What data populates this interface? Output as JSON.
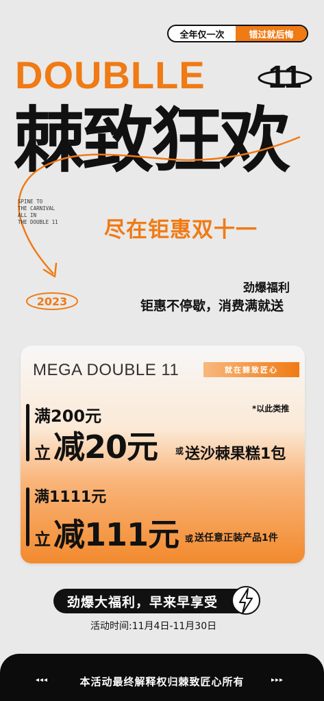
{
  "top_pill": {
    "left_text": "全年仅一次",
    "right_text": "错过就后悔"
  },
  "headline": {
    "text": "DOUBLLE",
    "number": "11"
  },
  "main_title": "棘致狂欢",
  "spine_text": [
    "SPINE TO",
    "THE CARNIVAL",
    "ALL IN",
    "THE DOUBLE 11"
  ],
  "subtitle": "尽在钜惠双十一",
  "year_badge": "2023",
  "benefit": {
    "title": "劲爆福利",
    "subtitle": "钜惠不停歇，消费满就送"
  },
  "card": {
    "title": "MEGA DOUBLE 11",
    "tag": "就在棘致匠心",
    "note": "*以此类推",
    "offer1": {
      "condition": "满200元",
      "prefix": "立",
      "discount": "减20元",
      "or": "或",
      "gift": "送沙棘果糕1包"
    },
    "offer2": {
      "condition": "满1111元",
      "prefix": "立",
      "discount": "减111元",
      "or": "或",
      "gift": "送任意正装产品1件"
    }
  },
  "banner": "劲爆大福利，早来早享受",
  "dates": "活动时间:11月4日-11月30日",
  "footer": {
    "text": "本活动最终解释权归棘致匠心所有",
    "left_arrows": "◂◂◂",
    "right_arrows": "▸▸▸"
  },
  "colors": {
    "accent": "#f07a14",
    "dark": "#111111",
    "background": "#e9e9e9"
  }
}
